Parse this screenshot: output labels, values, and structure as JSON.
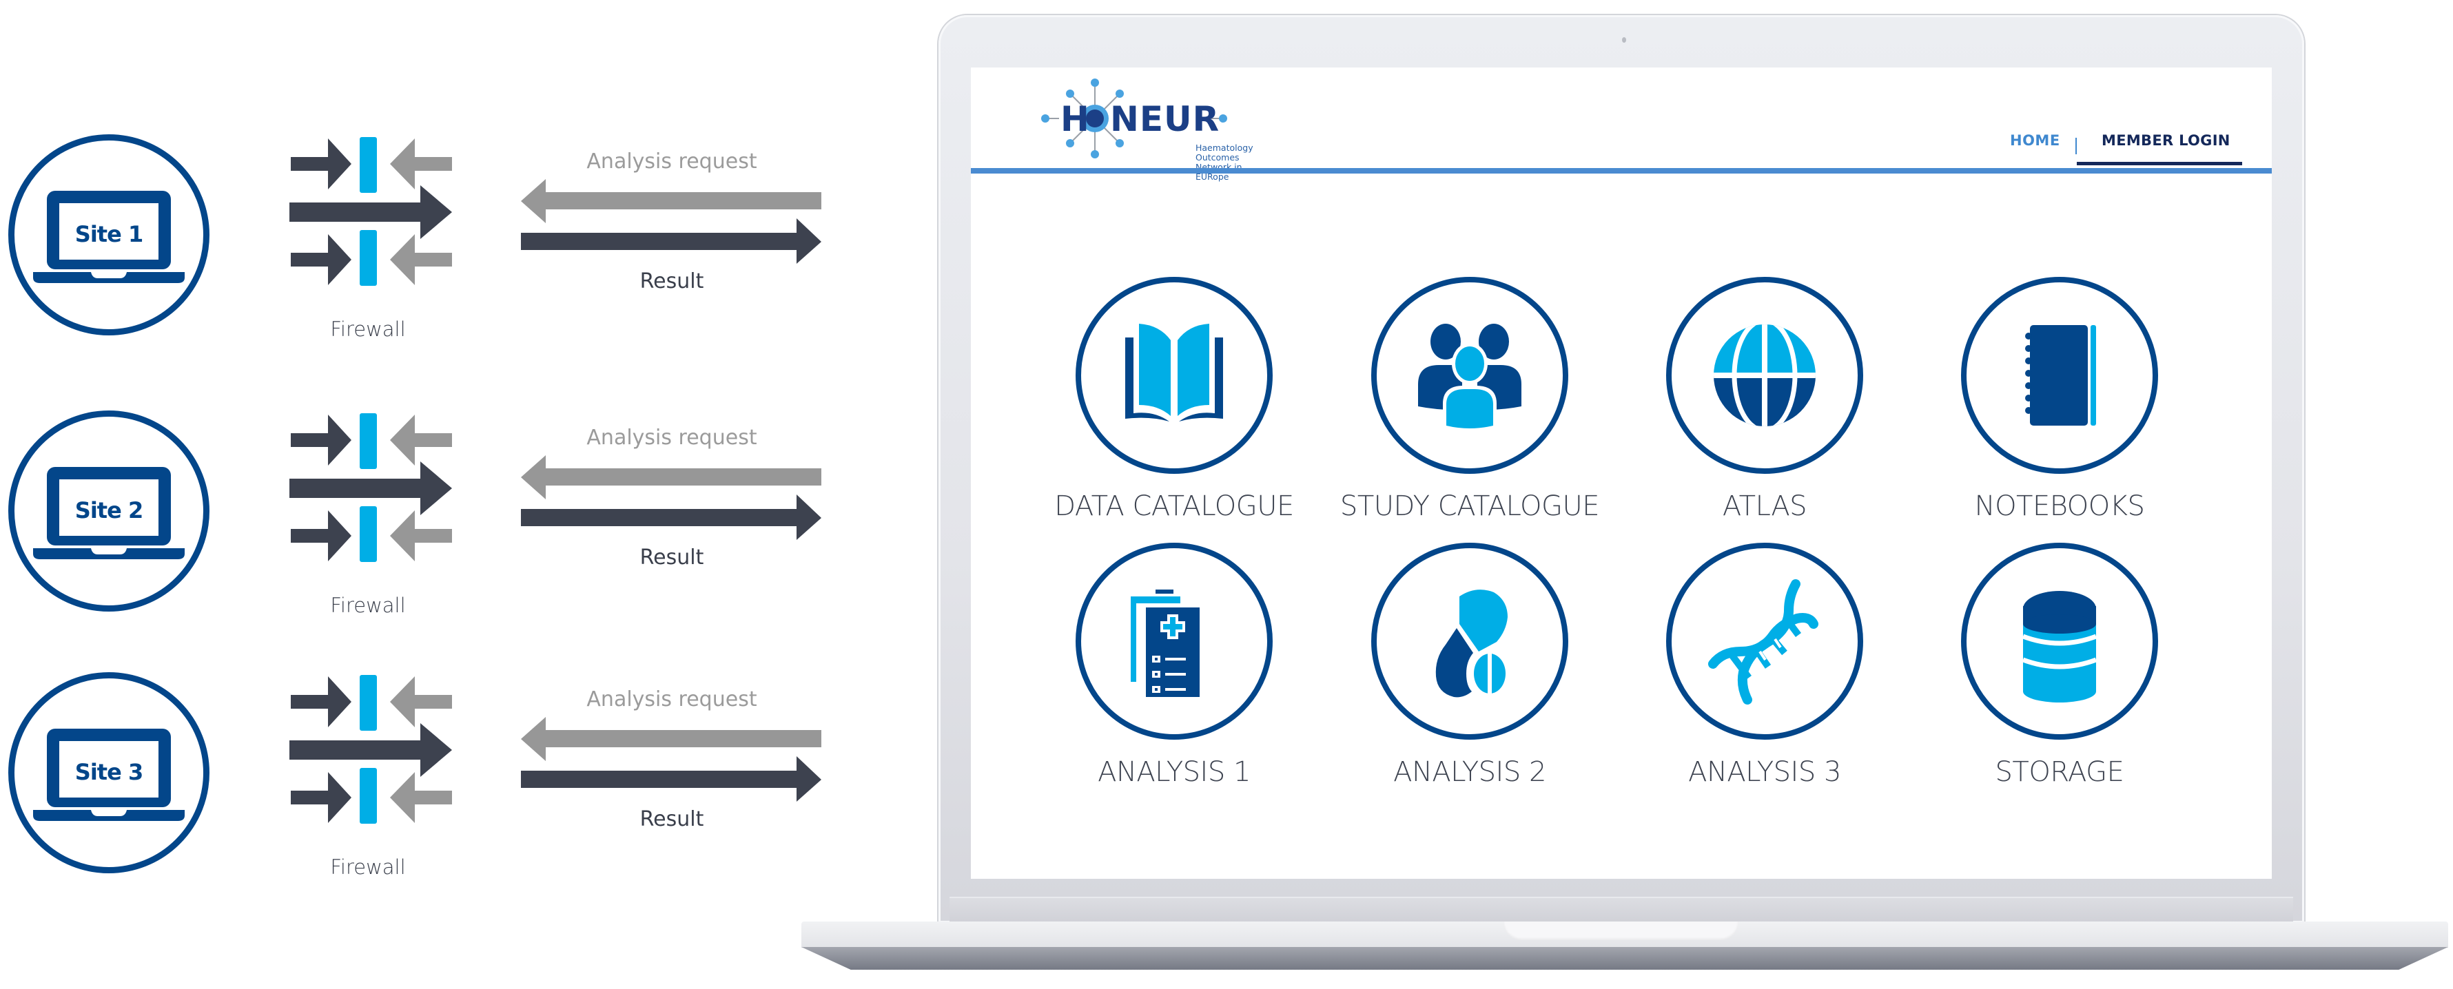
{
  "colors": {
    "navy": "#03468a",
    "cyan": "#00aee6",
    "dark_arrow": "#3d424f",
    "gray_arrow": "#979797",
    "header_blue": "#4a8bd1",
    "login_navy": "#14285a"
  },
  "diagram": {
    "sites": [
      {
        "label": "Site 1",
        "icon": "laptop-icon",
        "firewall_label": "Firewall",
        "request_label": "Analysis request",
        "result_label": "Result"
      },
      {
        "label": "Site 2",
        "icon": "laptop-icon",
        "firewall_label": "Firewall",
        "request_label": "Analysis request",
        "result_label": "Result"
      },
      {
        "label": "Site 3",
        "icon": "laptop-icon",
        "firewall_label": "Firewall",
        "request_label": "Analysis request",
        "result_label": "Result"
      }
    ]
  },
  "portal": {
    "logo": {
      "wordmark": "HONEUR",
      "subtitle_line1": "Haematology Outcomes",
      "subtitle_line2": "Network in EURope"
    },
    "nav": {
      "home": "HOME",
      "member_login": "MEMBER LOGIN",
      "active": "MEMBER LOGIN"
    },
    "tiles": [
      {
        "label": "DATA CATALOGUE",
        "icon": "open-book-icon"
      },
      {
        "label": "STUDY CATALOGUE",
        "icon": "people-group-icon"
      },
      {
        "label": "ATLAS",
        "icon": "globe-icon"
      },
      {
        "label": "NOTEBOOKS",
        "icon": "notebook-icon"
      },
      {
        "label": "ANALYSIS 1",
        "icon": "medical-clipboard-icon"
      },
      {
        "label": "ANALYSIS 2",
        "icon": "pills-icon"
      },
      {
        "label": "ANALYSIS 3",
        "icon": "dna-icon"
      },
      {
        "label": "STORAGE",
        "icon": "database-icon"
      }
    ]
  }
}
